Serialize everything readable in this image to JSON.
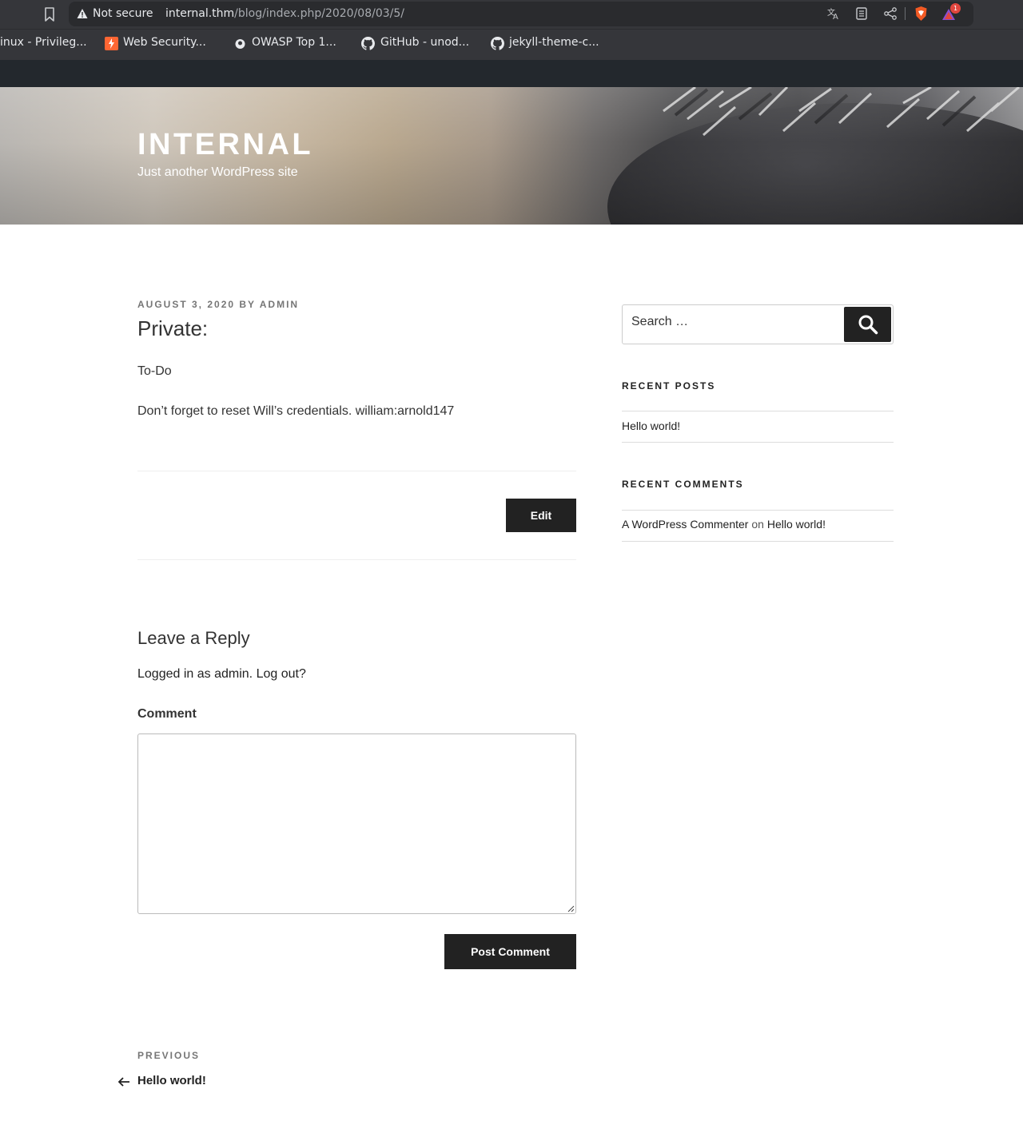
{
  "browser": {
    "not_secure": "Not secure",
    "url_host": "internal.thm",
    "url_path": "/blog/index.php/2020/08/03/5/",
    "extension_badge": "1"
  },
  "bookmarks": [
    {
      "label": "inux - Privileg...",
      "icon": "none"
    },
    {
      "label": "Web Security...",
      "icon": "portswigger-icon"
    },
    {
      "label": "OWASP Top 1...",
      "icon": "owasp-icon"
    },
    {
      "label": "GitHub - unod...",
      "icon": "github-icon"
    },
    {
      "label": "jekyll-theme-c...",
      "icon": "github-icon"
    }
  ],
  "site": {
    "title": "INTERNAL",
    "description": "Just another WordPress site"
  },
  "post": {
    "date": "AUGUST 3, 2020",
    "by": "BY",
    "author": "ADMIN",
    "title": "Private:",
    "paragraphs": [
      "To-Do",
      "Don’t forget to reset Will’s credentials. william:arnold147"
    ],
    "edit_label": "Edit"
  },
  "reply": {
    "title": "Leave a Reply",
    "logged_in_prefix": "Logged in as",
    "logged_in_user": "admin",
    "logout": "Log out?",
    "comment_label": "Comment",
    "comment_value": "",
    "submit_label": "Post Comment"
  },
  "nav": {
    "previous_label": "PREVIOUS",
    "previous_title": "Hello world!"
  },
  "sidebar": {
    "search_placeholder": "Search …",
    "recent_posts_title": "RECENT POSTS",
    "recent_posts": [
      "Hello world!"
    ],
    "recent_comments_title": "RECENT COMMENTS",
    "recent_comments": [
      {
        "author": "A WordPress Commenter",
        "on": "on",
        "post": "Hello world!"
      }
    ]
  },
  "colors": {
    "chrome": "#35363a",
    "admin_bar": "#23282d",
    "button": "#222222"
  }
}
